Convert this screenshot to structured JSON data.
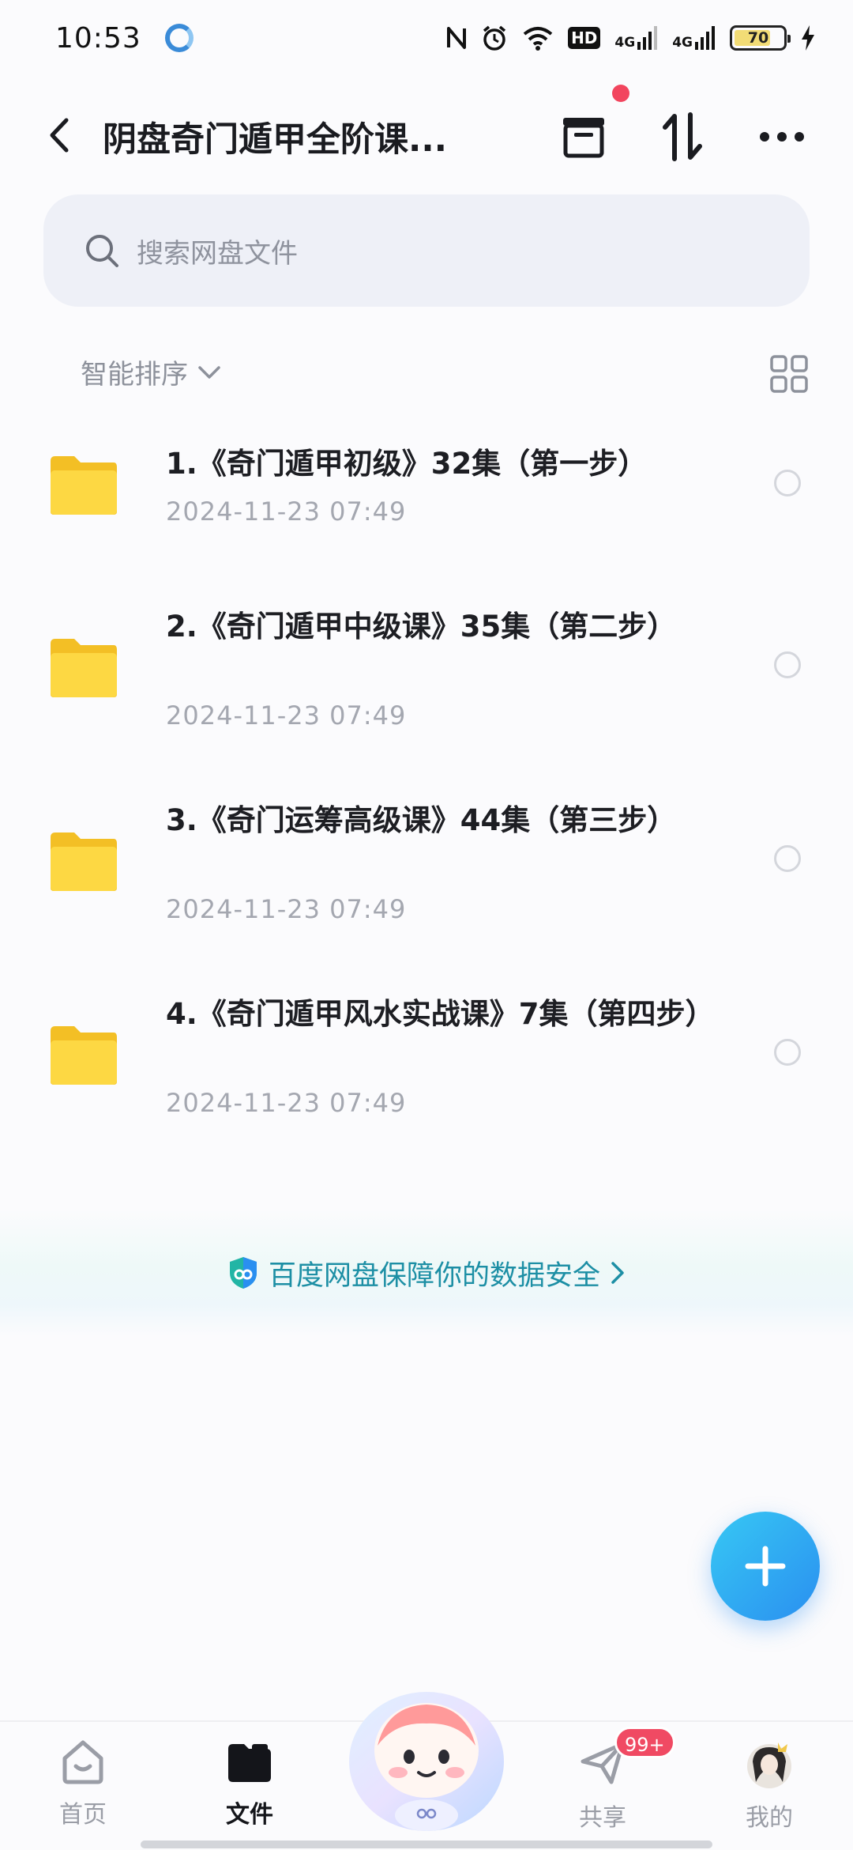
{
  "status_bar": {
    "time": "10:53",
    "network_1": "4G",
    "network_2": "4G",
    "hd_label": "HD",
    "battery": "70"
  },
  "header": {
    "title": "阴盘奇门遁甲全阶课...",
    "icons": [
      "back-icon",
      "transfer-box-icon",
      "sort-arrows-icon",
      "more-icon"
    ]
  },
  "search": {
    "placeholder": "搜索网盘文件"
  },
  "sort": {
    "label": "智能排序"
  },
  "files": [
    {
      "name": "1.《奇门遁甲初级》32集（第一步）",
      "date": "2024-11-23  07:49"
    },
    {
      "name": "2.《奇门遁甲中级课》35集（第二步）",
      "date": "2024-11-23  07:49"
    },
    {
      "name": "3.《奇门运筹高级课》44集（第三步）",
      "date": "2024-11-23  07:49"
    },
    {
      "name": "4.《奇门遁甲风水实战课》7集（第四步）",
      "date": "2024-11-23  07:49"
    }
  ],
  "security_banner": {
    "text": "百度网盘保障你的数据安全"
  },
  "bottom_nav": {
    "items": [
      {
        "label": "首页",
        "icon": "home-icon"
      },
      {
        "label": "文件",
        "icon": "folder-icon"
      },
      {
        "label": "共享",
        "icon": "share-icon",
        "badge": "99+"
      },
      {
        "label": "我的",
        "icon": "avatar"
      }
    ]
  },
  "colors": {
    "accent": "#2a8ff0",
    "badge": "#f04a63",
    "folder": "#fbd33f",
    "security_text": "#1d8fa5"
  }
}
